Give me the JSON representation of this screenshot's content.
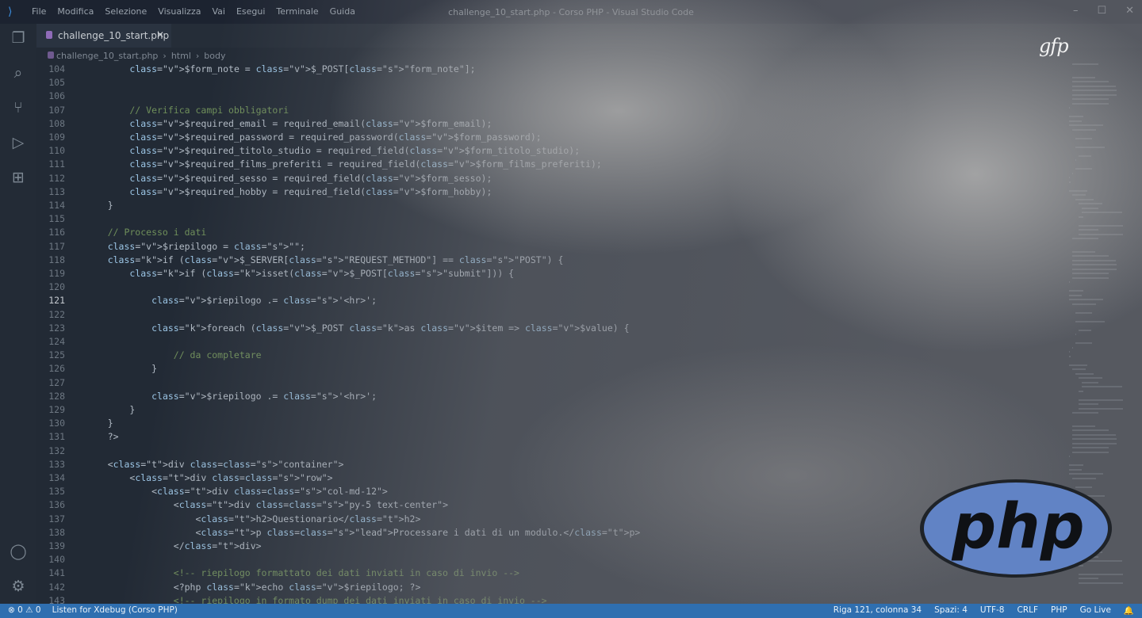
{
  "app": {
    "window_title": "challenge_10_start.php - Corso PHP - Visual Studio Code",
    "menu": [
      "File",
      "Modifica",
      "Selezione",
      "Visualizza",
      "Vai",
      "Esegui",
      "Terminale",
      "Guida"
    ]
  },
  "tab": {
    "label": "challenge_10_start.php",
    "close": "✕"
  },
  "breadcrumb": {
    "file": "challenge_10_start.php",
    "sep1": "›",
    "item1": "html",
    "sep2": "›",
    "item2": "body"
  },
  "watermark": "gfp",
  "logo_text": "php",
  "colors": {
    "status_bar": "#2f6fb0",
    "php_logo": "#6183c5"
  },
  "editor": {
    "active_line": 121,
    "lines": [
      {
        "n": 104,
        "code": "        $form_note = $_POST[\"form_note\"];"
      },
      {
        "n": 105,
        "code": ""
      },
      {
        "n": 106,
        "code": ""
      },
      {
        "n": 107,
        "code": "        // Verifica campi obbligatori"
      },
      {
        "n": 108,
        "code": "        $required_email = required_email($form_email);"
      },
      {
        "n": 109,
        "code": "        $required_password = required_password($form_password);"
      },
      {
        "n": 110,
        "code": "        $required_titolo_studio = required_field($form_titolo_studio);"
      },
      {
        "n": 111,
        "code": "        $required_films_preferiti = required_field($form_films_preferiti);"
      },
      {
        "n": 112,
        "code": "        $required_sesso = required_field($form_sesso);"
      },
      {
        "n": 113,
        "code": "        $required_hobby = required_field($form_hobby);"
      },
      {
        "n": 114,
        "code": "    }"
      },
      {
        "n": 115,
        "code": ""
      },
      {
        "n": 116,
        "code": "    // Processo i dati"
      },
      {
        "n": 117,
        "code": "    $riepilogo = \"\";"
      },
      {
        "n": 118,
        "code": "    if ($_SERVER[\"REQUEST_METHOD\"] == \"POST\") {"
      },
      {
        "n": 119,
        "code": "        if (isset($_POST[\"submit\"])) {"
      },
      {
        "n": 120,
        "code": ""
      },
      {
        "n": 121,
        "code": "            $riepilogo .= '<hr>';"
      },
      {
        "n": 122,
        "code": ""
      },
      {
        "n": 123,
        "code": "            foreach ($_POST as $item => $value) {"
      },
      {
        "n": 124,
        "code": ""
      },
      {
        "n": 125,
        "code": "                // da completare"
      },
      {
        "n": 126,
        "code": "            }"
      },
      {
        "n": 127,
        "code": ""
      },
      {
        "n": 128,
        "code": "            $riepilogo .= '<hr>';"
      },
      {
        "n": 129,
        "code": "        }"
      },
      {
        "n": 130,
        "code": "    }"
      },
      {
        "n": 131,
        "code": "    ?>"
      },
      {
        "n": 132,
        "code": ""
      },
      {
        "n": 133,
        "code": "    <div class=\"container\">"
      },
      {
        "n": 134,
        "code": "        <div class=\"row\">"
      },
      {
        "n": 135,
        "code": "            <div class=\"col-md-12\">"
      },
      {
        "n": 136,
        "code": "                <div class=\"py-5 text-center\">"
      },
      {
        "n": 137,
        "code": "                    <h2>Questionario</h2>"
      },
      {
        "n": 138,
        "code": "                    <p class=\"lead\">Processare i dati di un modulo.</p>"
      },
      {
        "n": 139,
        "code": "                </div>"
      },
      {
        "n": 140,
        "code": ""
      },
      {
        "n": 141,
        "code": "                <!-- riepilogo formattato dei dati inviati in caso di invio -->"
      },
      {
        "n": 142,
        "code": "                <?php echo $riepilogo; ?>"
      },
      {
        "n": 143,
        "code": "                <!-- riepilogo in formato dump dei dati inviati in caso di invio -->"
      }
    ]
  },
  "status": {
    "errors": "⊗ 0",
    "warnings": "⚠ 0",
    "xdebug": "Listen for Xdebug (Corso PHP)",
    "position": "Riga 121, colonna 34",
    "spaces": "Spazi: 4",
    "encoding": "UTF-8",
    "eol": "CRLF",
    "language": "PHP",
    "golive": "Go Live"
  }
}
